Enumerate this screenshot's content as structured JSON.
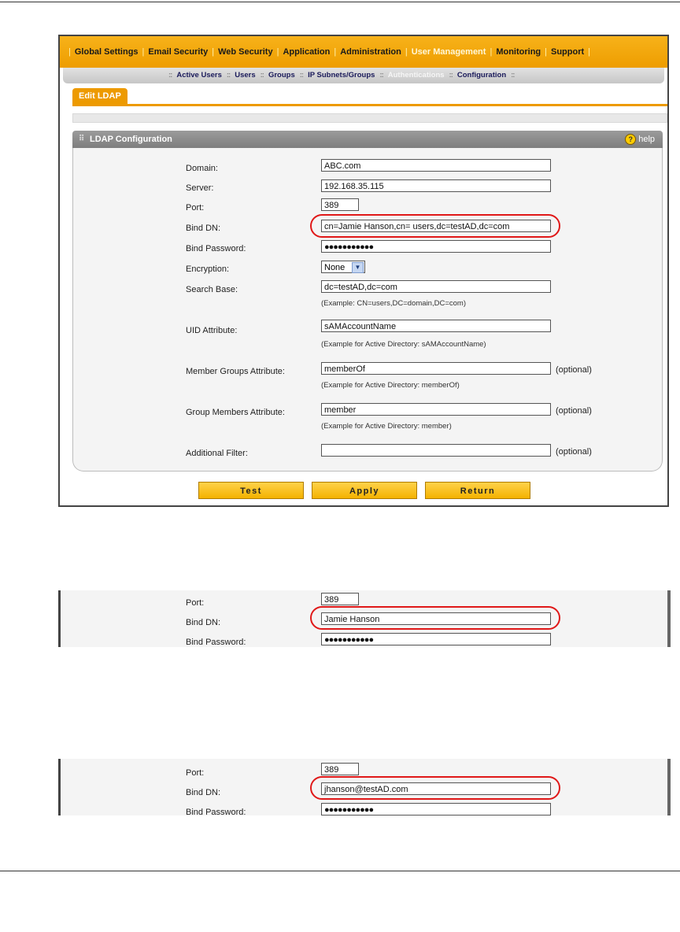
{
  "top_nav": [
    "Global Settings",
    "Email Security",
    "Web Security",
    "Application",
    "Administration",
    "User Management",
    "Monitoring",
    "Support"
  ],
  "sub_nav": [
    "Active Users",
    "Users",
    "Groups",
    "IP Subnets/Groups",
    "Authentications",
    "Configuration"
  ],
  "tab": "Edit LDAP",
  "section": {
    "title": "LDAP Configuration",
    "help": "help"
  },
  "form": {
    "domain": {
      "label": "Domain:",
      "value": "ABC.com"
    },
    "server": {
      "label": "Server:",
      "value": "192.168.35.115"
    },
    "port": {
      "label": "Port:",
      "value": "389"
    },
    "bind_dn": {
      "label": "Bind DN:",
      "value": "cn=Jamie Hanson,cn= users,dc=testAD,dc=com"
    },
    "bind_password": {
      "label": "Bind Password:",
      "value": "●●●●●●●●●●●"
    },
    "encryption": {
      "label": "Encryption:",
      "value": "None"
    },
    "search_base": {
      "label": "Search Base:",
      "value": "dc=testAD,dc=com",
      "example": "(Example: CN=users,DC=domain,DC=com)"
    },
    "uid_attribute": {
      "label": "UID Attribute:",
      "value": "sAMAccountName",
      "example": "(Example for Active Directory: sAMAccountName)"
    },
    "member_groups": {
      "label": "Member Groups Attribute:",
      "value": "memberOf",
      "example": "(Example for Active Directory: memberOf)",
      "optional": "(optional)"
    },
    "group_members": {
      "label": "Group Members Attribute:",
      "value": "member",
      "example": "(Example for Active Directory: member)",
      "optional": "(optional)"
    },
    "additional_filter": {
      "label": "Additional Filter:",
      "value": "",
      "optional": "(optional)"
    }
  },
  "buttons": {
    "test": "Test",
    "apply": "Apply",
    "return": "Return"
  },
  "crop1": {
    "port": "389",
    "bind_dn": "Jamie Hanson",
    "password": "●●●●●●●●●●●"
  },
  "crop2": {
    "port": "389",
    "bind_dn": "jhanson@testAD.com",
    "password": "●●●●●●●●●●●"
  },
  "labels": {
    "port": "Port:",
    "bind_dn": "Bind DN:",
    "bind_password": "Bind Password:"
  }
}
